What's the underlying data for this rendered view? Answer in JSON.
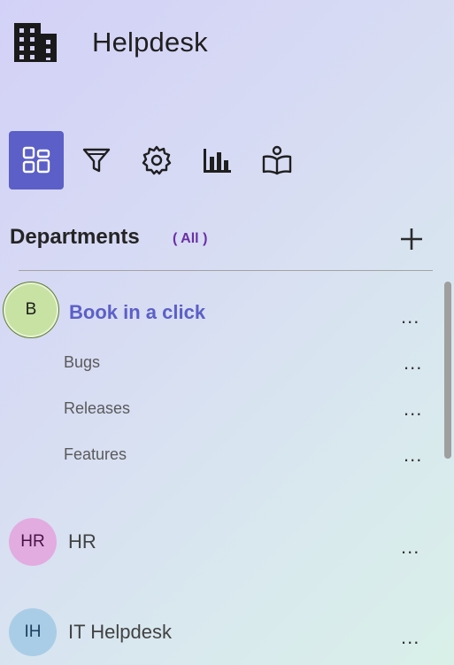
{
  "header": {
    "title": "Helpdesk",
    "logo_icon": "building-icon"
  },
  "toolbar": {
    "items": [
      {
        "name": "dashboard",
        "icon": "grid-icon",
        "active": true
      },
      {
        "name": "filter",
        "icon": "funnel-icon",
        "active": false
      },
      {
        "name": "settings",
        "icon": "gear-icon",
        "active": false
      },
      {
        "name": "reports",
        "icon": "bar-chart-icon",
        "active": false
      },
      {
        "name": "knowledge",
        "icon": "book-user-icon",
        "active": false
      }
    ],
    "accent": "#5b5fc7"
  },
  "departments": {
    "title": "Departments",
    "filter_label": "( All )",
    "items": [
      {
        "initials": "B",
        "name": "Book in a click",
        "more": "...",
        "children": [
          {
            "name": "Bugs",
            "more": "..."
          },
          {
            "name": "Releases",
            "more": "..."
          },
          {
            "name": "Features",
            "more": "..."
          }
        ]
      },
      {
        "initials": "HR",
        "name": "HR",
        "more": "..."
      },
      {
        "initials": "IH",
        "name": "IT Helpdesk",
        "more": "..."
      }
    ]
  }
}
